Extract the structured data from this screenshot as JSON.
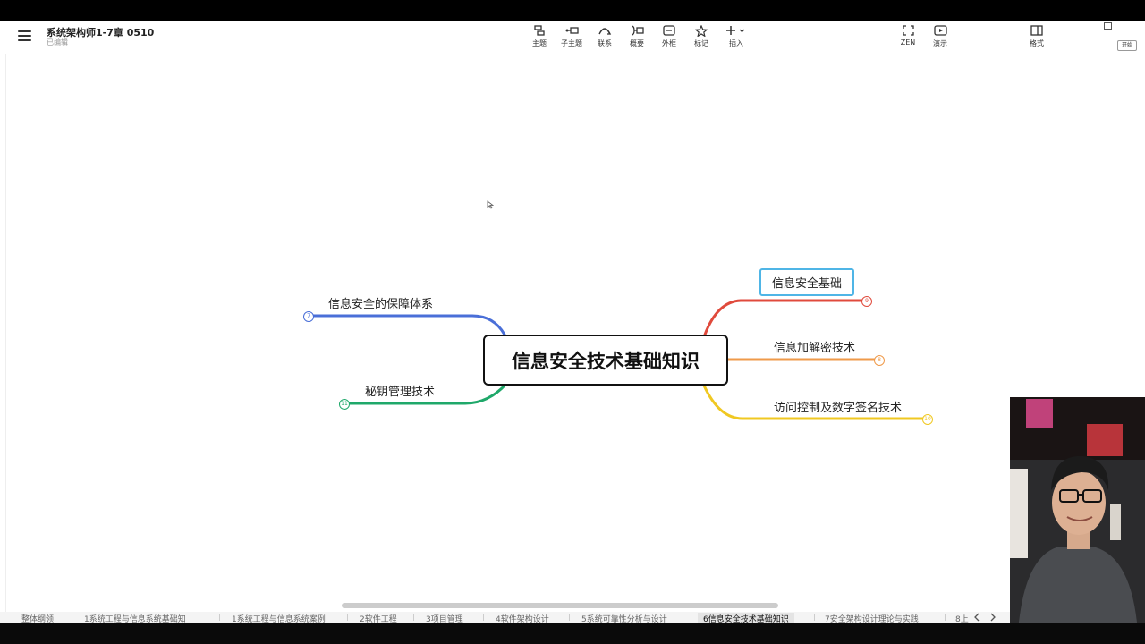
{
  "app": {
    "title": "系统架构师1-7章 0510",
    "status": "已编辑"
  },
  "toolbar": {
    "items": [
      {
        "label": "主题",
        "icon": "topic-icon"
      },
      {
        "label": "子主题",
        "icon": "subtopic-icon"
      },
      {
        "label": "联系",
        "icon": "relationship-icon"
      },
      {
        "label": "概要",
        "icon": "summary-icon"
      },
      {
        "label": "外框",
        "icon": "boundary-icon"
      },
      {
        "label": "标记",
        "icon": "star-icon"
      },
      {
        "label": "插入",
        "icon": "plus-icon"
      }
    ],
    "right": [
      {
        "label": "ZEN",
        "icon": "fullscreen-icon"
      },
      {
        "label": "演示",
        "icon": "play-icon"
      },
      {
        "label": "格式",
        "icon": "format-panel-icon"
      }
    ],
    "start_label": "开始"
  },
  "mindmap": {
    "central": "信息安全技术基础知识",
    "branches": [
      {
        "label": "信息安全的保障体系",
        "count": "7",
        "color": "#4a6fd8"
      },
      {
        "label": "秘钥管理技术",
        "count": "11",
        "color": "#1fa86a"
      },
      {
        "label": "信息安全基础",
        "count": "9",
        "color": "#e04a3c"
      },
      {
        "label": "信息加解密技术",
        "count": "8",
        "color": "#ef9a4a"
      },
      {
        "label": "访问控制及数字签名技术",
        "count": "10",
        "color": "#f0c822"
      }
    ]
  },
  "tabs": [
    "整体纲领",
    "1系统工程与信息系统基础知",
    "1系统工程与信息系统案例",
    "2软件工程",
    "3项目管理",
    "4软件架构设计",
    "5系统可靠性分析与设计",
    "6信息安全技术基础知识",
    "7安全架构设计理论与实践",
    "8上"
  ],
  "active_tab": "6信息安全技术基础知识"
}
